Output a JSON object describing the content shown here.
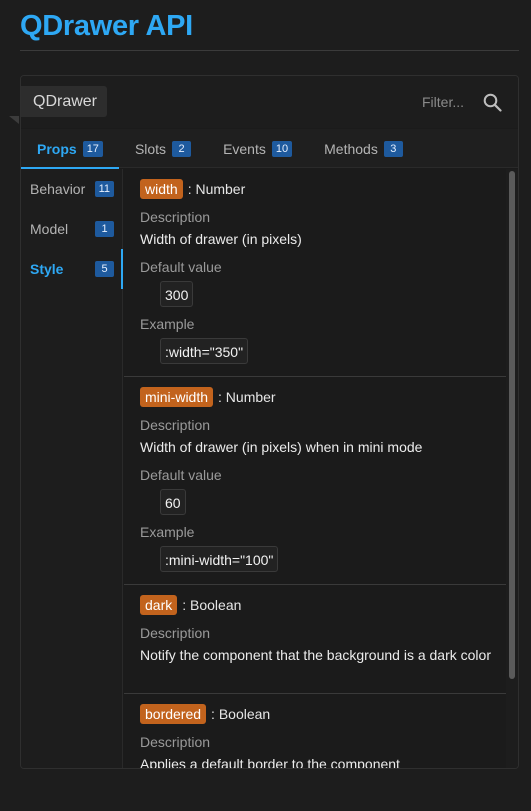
{
  "page": {
    "title": "QDrawer API"
  },
  "card": {
    "component_name": "QDrawer",
    "filter_placeholder": "Filter..."
  },
  "tabs": [
    {
      "label": "Props",
      "count": "17",
      "active": true
    },
    {
      "label": "Slots",
      "count": "2",
      "active": false
    },
    {
      "label": "Events",
      "count": "10",
      "active": false
    },
    {
      "label": "Methods",
      "count": "3",
      "active": false
    }
  ],
  "categories": [
    {
      "label": "Behavior",
      "count": "11",
      "active": false
    },
    {
      "label": "Model",
      "count": "1",
      "active": false
    },
    {
      "label": "Style",
      "count": "5",
      "active": true
    }
  ],
  "props": [
    {
      "name": "width",
      "type": ": Number",
      "description_label": "Description",
      "description": "Width of drawer (in pixels)",
      "default_label": "Default value",
      "default": "300",
      "example_label": "Example",
      "example": ":width=\"350\""
    },
    {
      "name": "mini-width",
      "type": ": Number",
      "description_label": "Description",
      "description": "Width of drawer (in pixels) when in mini mode",
      "default_label": "Default value",
      "default": "60",
      "example_label": "Example",
      "example": ":mini-width=\"100\""
    },
    {
      "name": "dark",
      "type": ": Boolean",
      "description_label": "Description",
      "description": "Notify the component that the background is a dark color"
    },
    {
      "name": "bordered",
      "type": ": Boolean",
      "description_label": "Description",
      "description": "Applies a default border to the component"
    }
  ],
  "icons": {
    "search": "search-icon"
  },
  "colors": {
    "accent": "#2ea8f4",
    "prop_name_bg": "#c2631d",
    "count_badge_bg": "#1e5a9e"
  }
}
